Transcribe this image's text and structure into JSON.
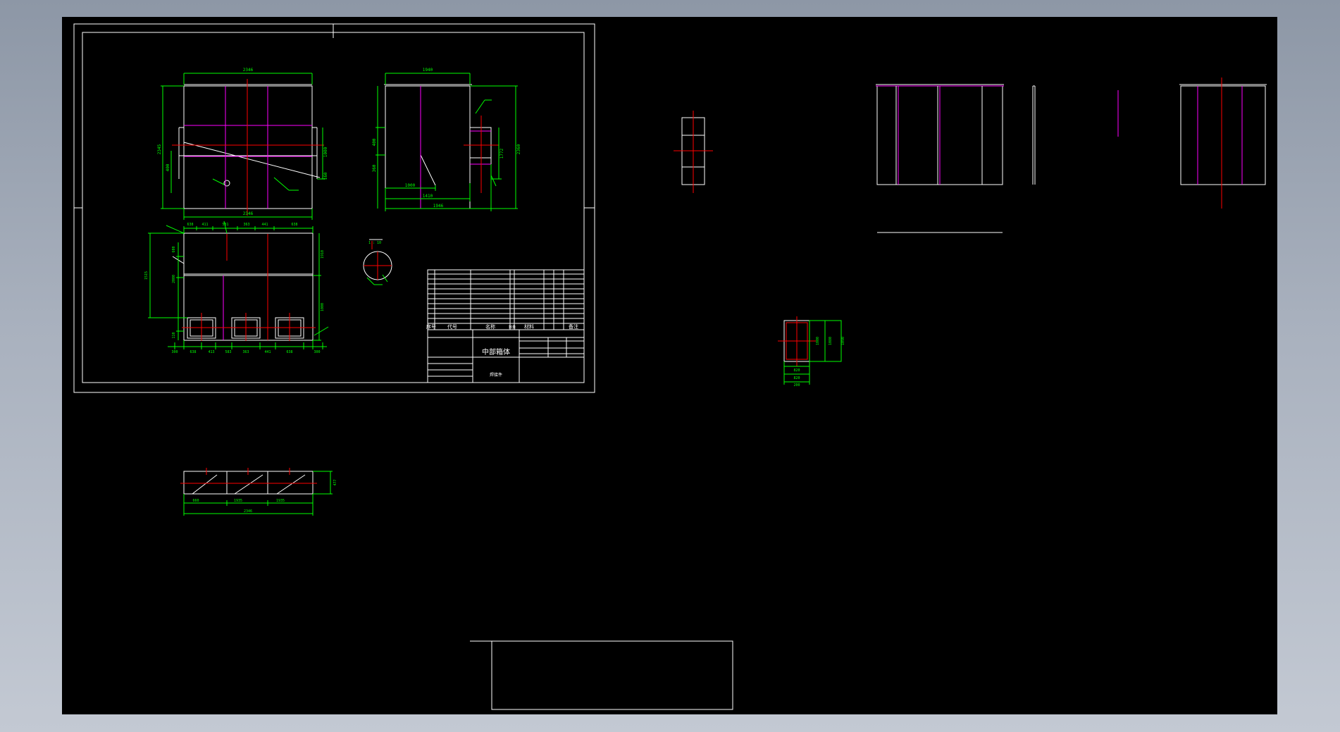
{
  "colors": {
    "background": "#000000",
    "line_white": "#ffffff",
    "dimension_green": "#00ff00",
    "centerline_red": "#ff0000",
    "member_magenta": "#ff00ff"
  },
  "title_block": {
    "title": "中部箱体",
    "subtitle": "焊接件",
    "header_seq": "序号",
    "header_code": "代号",
    "header_name": "名称",
    "header_qty": "数量",
    "header_material": "材料",
    "header_note": "备注"
  },
  "detail_scale": "1 : 10",
  "dimensions": {
    "top_width": "2346",
    "top_base": "2346",
    "top_height": "2345",
    "top_h1": "1000",
    "top_h2": "400",
    "top_h3": "160",
    "side_width": "1940",
    "side_h1": "400",
    "side_h2": "360",
    "side_total_height": "2360",
    "side_part_height": "1772",
    "side_bottom_1": "1000",
    "side_bottom_2": "1410",
    "side_bottom_3": "1946",
    "plan_top_1": "638",
    "plan_top_2": "411",
    "plan_top_3": "581",
    "plan_top_4": "363",
    "plan_top_5": "441",
    "plan_top_6": "638",
    "plan_left_1": "1515",
    "plan_left_2": "600",
    "plan_left_3": "2000",
    "plan_left_4": "110",
    "plan_right_1": "1910",
    "plan_right_2": "1000",
    "plan_bottom_1": "300",
    "plan_bottom_2": "638",
    "plan_bottom_3": "413",
    "plan_bottom_4": "583",
    "plan_bottom_5": "363",
    "plan_bottom_6": "441",
    "plan_bottom_7": "638",
    "plan_bottom_8": "300",
    "strip_1": "660",
    "strip_2": "1935",
    "strip_3": "1935",
    "strip_total": "2346",
    "strip_right": "477",
    "section_1": "820",
    "section_2": "1000",
    "section_3": "1080",
    "section_4": "1090",
    "section_5": "820",
    "section_6": "200"
  }
}
